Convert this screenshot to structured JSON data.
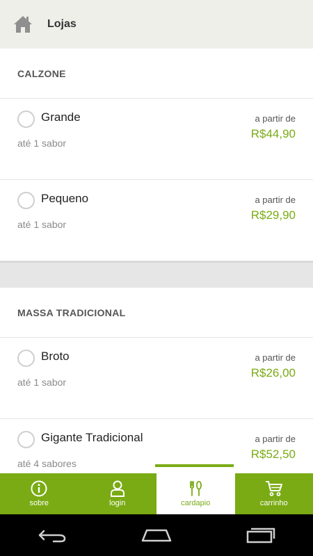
{
  "header": {
    "title": "Lojas",
    "home_icon": "home-icon"
  },
  "sections": [
    {
      "title": "CALZONE",
      "items": [
        {
          "name": "Grande",
          "sub": "até 1 sabor",
          "from": "a partir de",
          "price": "R$44,90"
        },
        {
          "name": "Pequeno",
          "sub": "até 1 sabor",
          "from": "a partir de",
          "price": "R$29,90"
        }
      ]
    },
    {
      "title": "MASSA TRADICIONAL",
      "items": [
        {
          "name": "Broto",
          "sub": "até 1 sabor",
          "from": "a partir de",
          "price": "R$26,00"
        },
        {
          "name": "Gigante Tradicional",
          "sub": "até 4 sabores",
          "from": "a partir de",
          "price": "R$52,50"
        }
      ]
    }
  ],
  "tabs": [
    {
      "label": "sobre",
      "icon": "info-icon"
    },
    {
      "label": "login",
      "icon": "user-icon"
    },
    {
      "label": "cardapio",
      "icon": "cutlery-icon",
      "active": true
    },
    {
      "label": "carrinho",
      "icon": "cart-icon"
    }
  ],
  "colors": {
    "accent": "#7aab14",
    "header_bg": "#efefea"
  }
}
